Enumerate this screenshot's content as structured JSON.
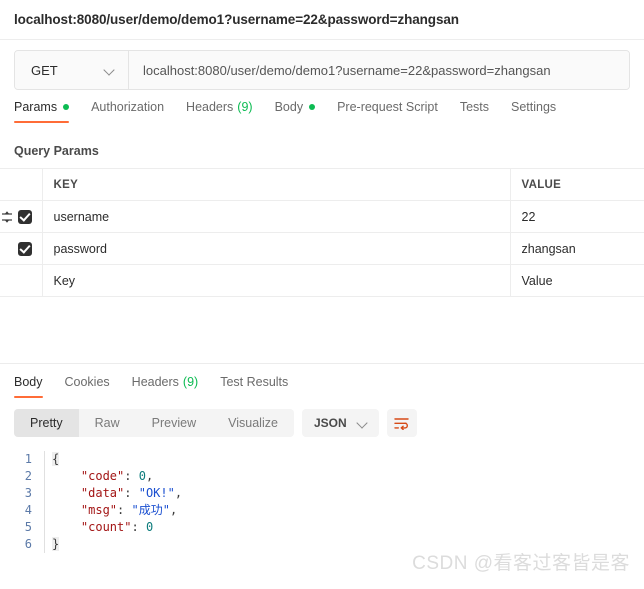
{
  "request": {
    "title": "localhost:8080/user/demo/demo1?username=22&password=zhangsan",
    "method": "GET",
    "url": "localhost:8080/user/demo/demo1?username=22&password=zhangsan",
    "tabs": [
      {
        "label": "Params",
        "indicator": "dot",
        "active": true
      },
      {
        "label": "Authorization",
        "indicator": "",
        "active": false
      },
      {
        "label": "Headers",
        "indicator": "(9)",
        "active": false
      },
      {
        "label": "Body",
        "indicator": "dot",
        "active": false
      },
      {
        "label": "Pre-request Script",
        "indicator": "",
        "active": false
      },
      {
        "label": "Tests",
        "indicator": "",
        "active": false
      },
      {
        "label": "Settings",
        "indicator": "",
        "active": false
      }
    ]
  },
  "params": {
    "section_title": "Query Params",
    "columns": [
      "KEY",
      "VALUE"
    ],
    "rows": [
      {
        "checked": true,
        "key": "username",
        "value": "22",
        "placeholder": false,
        "handle": true
      },
      {
        "checked": true,
        "key": "password",
        "value": "zhangsan",
        "placeholder": false,
        "handle": false
      },
      {
        "checked": false,
        "key": "Key",
        "value": "Value",
        "placeholder": true,
        "handle": false
      }
    ]
  },
  "response": {
    "tabs": [
      {
        "label": "Body",
        "indicator": "",
        "active": true
      },
      {
        "label": "Cookies",
        "indicator": "",
        "active": false
      },
      {
        "label": "Headers",
        "indicator": "(9)",
        "active": false
      },
      {
        "label": "Test Results",
        "indicator": "",
        "active": false
      }
    ],
    "view_modes": [
      "Pretty",
      "Raw",
      "Preview",
      "Visualize"
    ],
    "active_view_mode": "Pretty",
    "format": "JSON",
    "wrap_icon": "wrap-text-icon",
    "body_lines": [
      {
        "n": "1",
        "tokens": [
          {
            "t": "brace",
            "v": "{"
          }
        ]
      },
      {
        "n": "2",
        "tokens": [
          {
            "t": "plain",
            "v": "    "
          },
          {
            "t": "key",
            "v": "\"code\""
          },
          {
            "t": "punc",
            "v": ": "
          },
          {
            "t": "num",
            "v": "0"
          },
          {
            "t": "punc",
            "v": ","
          }
        ]
      },
      {
        "n": "3",
        "tokens": [
          {
            "t": "plain",
            "v": "    "
          },
          {
            "t": "key",
            "v": "\"data\""
          },
          {
            "t": "punc",
            "v": ": "
          },
          {
            "t": "str",
            "v": "\"OK!\""
          },
          {
            "t": "punc",
            "v": ","
          }
        ]
      },
      {
        "n": "4",
        "tokens": [
          {
            "t": "plain",
            "v": "    "
          },
          {
            "t": "key",
            "v": "\"msg\""
          },
          {
            "t": "punc",
            "v": ": "
          },
          {
            "t": "str",
            "v": "\"成功\""
          },
          {
            "t": "punc",
            "v": ","
          }
        ]
      },
      {
        "n": "5",
        "tokens": [
          {
            "t": "plain",
            "v": "    "
          },
          {
            "t": "key",
            "v": "\"count\""
          },
          {
            "t": "punc",
            "v": ": "
          },
          {
            "t": "num",
            "v": "0"
          }
        ]
      },
      {
        "n": "6",
        "tokens": [
          {
            "t": "brace",
            "v": "}"
          }
        ]
      }
    ]
  },
  "watermark": "CSDN @看客过客皆是客",
  "colors": {
    "accent": "#ff6c37",
    "green": "#0cbb52",
    "text": "#2c2c2c",
    "muted": "#6b6b6b"
  }
}
